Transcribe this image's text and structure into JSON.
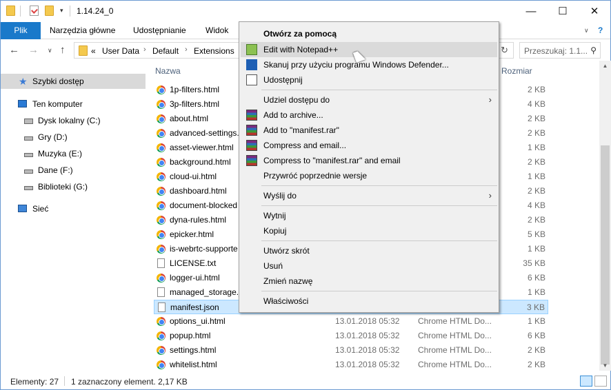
{
  "window": {
    "title": "1.14.24_0",
    "controls": {
      "minimize": "—",
      "maximize": "☐",
      "close": "✕"
    }
  },
  "ribbon": {
    "tabs": [
      "Plik",
      "Narzędzia główne",
      "Udostępnianie",
      "Widok"
    ],
    "expand_icon": "chevron-down-icon",
    "help": "?"
  },
  "address": {
    "overflow": "«",
    "crumbs": [
      "User Data",
      "Default",
      "Extensions"
    ],
    "search_placeholder": "Przeszukaj: 1.1..."
  },
  "nav_pane": {
    "items": [
      {
        "label": "Szybki dostęp",
        "icon": "star-icon"
      },
      {
        "label": "Ten komputer",
        "icon": "computer-icon"
      },
      {
        "label": "Dysk lokalny (C:)",
        "icon": "windows-drive-icon"
      },
      {
        "label": "Gry (D:)",
        "icon": "drive-icon"
      },
      {
        "label": "Muzyka (E:)",
        "icon": "drive-icon"
      },
      {
        "label": "Dane (F:)",
        "icon": "drive-icon"
      },
      {
        "label": "Biblioteki (G:)",
        "icon": "drive-icon"
      },
      {
        "label": "Sieć",
        "icon": "network-icon"
      }
    ]
  },
  "columns": {
    "name": "Nazwa",
    "size": "Rozmiar"
  },
  "files": [
    {
      "name": "1p-filters.html",
      "date": "",
      "type": "",
      "size": "2 KB",
      "icon": "chrome"
    },
    {
      "name": "3p-filters.html",
      "date": "",
      "type": "",
      "size": "4 KB",
      "icon": "chrome"
    },
    {
      "name": "about.html",
      "date": "",
      "type": "",
      "size": "2 KB",
      "icon": "chrome"
    },
    {
      "name": "advanced-settings.",
      "date": "",
      "type": "",
      "size": "2 KB",
      "icon": "chrome"
    },
    {
      "name": "asset-viewer.html",
      "date": "",
      "type": "",
      "size": "1 KB",
      "icon": "chrome"
    },
    {
      "name": "background.html",
      "date": "",
      "type": "",
      "size": "2 KB",
      "icon": "chrome"
    },
    {
      "name": "cloud-ui.html",
      "date": "",
      "type": "",
      "size": "1 KB",
      "icon": "chrome"
    },
    {
      "name": "dashboard.html",
      "date": "",
      "type": "",
      "size": "2 KB",
      "icon": "chrome"
    },
    {
      "name": "document-blocked",
      "date": "",
      "type": "",
      "size": "4 KB",
      "icon": "chrome"
    },
    {
      "name": "dyna-rules.html",
      "date": "",
      "type": "",
      "size": "2 KB",
      "icon": "chrome"
    },
    {
      "name": "epicker.html",
      "date": "",
      "type": "",
      "size": "5 KB",
      "icon": "chrome"
    },
    {
      "name": "is-webrtc-supporte",
      "date": "",
      "type": "",
      "size": "1 KB",
      "icon": "chrome"
    },
    {
      "name": "LICENSE.txt",
      "date": "",
      "type": "",
      "size": "35 KB",
      "icon": "doc"
    },
    {
      "name": "logger-ui.html",
      "date": "",
      "type": "",
      "size": "6 KB",
      "icon": "chrome"
    },
    {
      "name": "managed_storage.j",
      "date": "",
      "type": "",
      "size": "1 KB",
      "icon": "doc"
    },
    {
      "name": "manifest.json",
      "date": "",
      "type": "",
      "size": "3 KB",
      "icon": "doc",
      "selected": true
    },
    {
      "name": "options_ui.html",
      "date": "13.01.2018 05:32",
      "type": "Chrome HTML Do...",
      "size": "1 KB",
      "icon": "chrome"
    },
    {
      "name": "popup.html",
      "date": "13.01.2018 05:32",
      "type": "Chrome HTML Do...",
      "size": "6 KB",
      "icon": "chrome"
    },
    {
      "name": "settings.html",
      "date": "13.01.2018 05:32",
      "type": "Chrome HTML Do...",
      "size": "2 KB",
      "icon": "chrome"
    },
    {
      "name": "whitelist.html",
      "date": "13.01.2018 05:32",
      "type": "Chrome HTML Do...",
      "size": "2 KB",
      "icon": "chrome"
    }
  ],
  "status": {
    "count": "Elementy: 27",
    "selection": "1 zaznaczony element. 2,17 KB"
  },
  "context_menu": {
    "items": [
      {
        "label": "Otwórz za pomocą",
        "bold": true,
        "icon": ""
      },
      {
        "label": "Edit with Notepad++",
        "icon": "notepadpp-icon",
        "highlighted": true
      },
      {
        "label": "Skanuj przy użyciu programu Windows Defender...",
        "icon": "defender-icon"
      },
      {
        "label": "Udostępnij",
        "icon": "share-icon"
      },
      {
        "label": "Udziel dostępu do",
        "submenu": true,
        "icon": ""
      },
      {
        "label": "Add to archive...",
        "icon": "winrar-icon"
      },
      {
        "label": "Add to \"manifest.rar\"",
        "icon": "winrar-icon"
      },
      {
        "label": "Compress and email...",
        "icon": "winrar-icon"
      },
      {
        "label": "Compress to \"manifest.rar\" and email",
        "icon": "winrar-icon"
      },
      {
        "label": "Przywróć poprzednie wersje",
        "icon": ""
      },
      {
        "label": "Wyślij do",
        "submenu": true,
        "icon": ""
      },
      {
        "label": "Wytnij",
        "icon": ""
      },
      {
        "label": "Kopiuj",
        "icon": ""
      },
      {
        "label": "Utwórz skrót",
        "icon": ""
      },
      {
        "label": "Usuń",
        "icon": ""
      },
      {
        "label": "Zmień nazwę",
        "icon": ""
      },
      {
        "label": "Właściwości",
        "icon": ""
      }
    ],
    "submenu_arrow": "›"
  }
}
